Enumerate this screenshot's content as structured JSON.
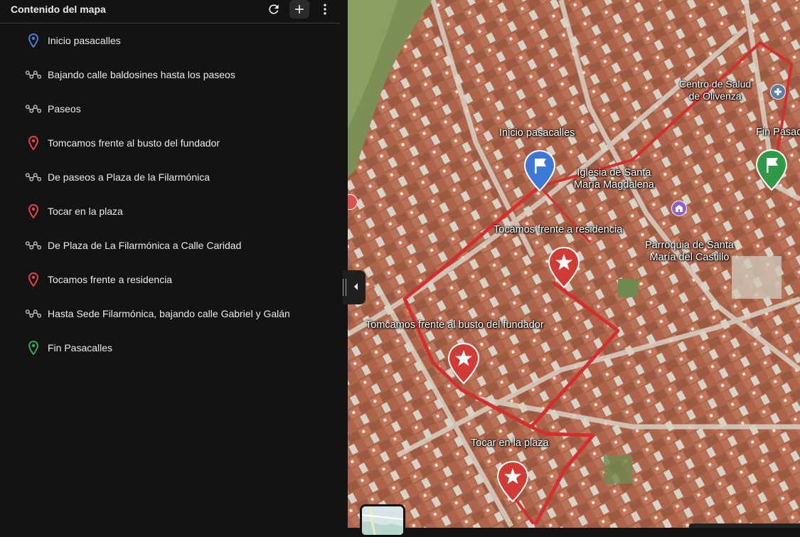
{
  "sidebar": {
    "title": "Contenido del mapa",
    "items": [
      {
        "label": "Inicio pasacalles",
        "type": "placemark",
        "color": "#4a7fd6"
      },
      {
        "label": "Bajando calle baldosines hasta los paseos",
        "type": "path",
        "color": "#bdbdbd"
      },
      {
        "label": "Paseos",
        "type": "path",
        "color": "#bdbdbd"
      },
      {
        "label": "Tomcamos frente al busto del fundador",
        "type": "placemark",
        "color": "#e0453a"
      },
      {
        "label": "De paseos a Plaza de la Filarmónica",
        "type": "path",
        "color": "#bdbdbd"
      },
      {
        "label": "Tocar en la plaza",
        "type": "placemark",
        "color": "#e0453a"
      },
      {
        "label": "De Plaza de La Filarmónica a Calle Caridad",
        "type": "path",
        "color": "#bdbdbd"
      },
      {
        "label": "Tocamos frente a residencia",
        "type": "placemark",
        "color": "#e0453a"
      },
      {
        "label": "Hasta Sede Filarmónica, bajando calle Gabriel y Galán",
        "type": "path",
        "color": "#bdbdbd"
      },
      {
        "label": "Fin Pasacalles",
        "type": "placemark",
        "color": "#34a853"
      }
    ]
  },
  "map": {
    "labels": {
      "centro_salud": "Centro de Salud\nde Olivenza",
      "inicio": "Inicio pasacalles",
      "fin": "Fin Pasacalles",
      "iglesia": "Iglesia de Santa\nMaría Magdalena",
      "residencia": "Tocamos frente a residencia",
      "parroquia": "Parroquia de Santa\nMaría del Castillo",
      "busto": "Tomcamos frente al busto del fundador",
      "plaza": "Tocar en la plaza"
    },
    "colors": {
      "route": "#d32f2f",
      "blue_marker": "#3b78d8",
      "red_marker": "#d23b35",
      "green_marker": "#2e9a47"
    }
  },
  "icons": {
    "refresh": "refresh-icon",
    "add": "plus-icon",
    "more": "more-vert-icon",
    "placemark": "location-pin-icon",
    "path": "path-icon",
    "collapse": "chevron-left-icon"
  }
}
